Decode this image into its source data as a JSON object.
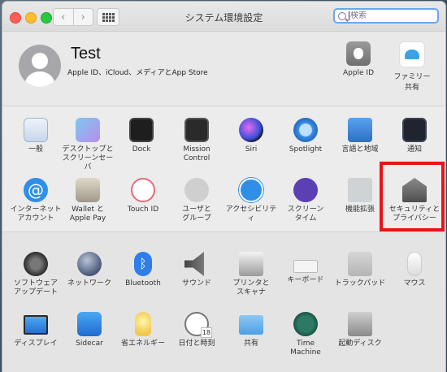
{
  "window": {
    "title": "システム環境設定"
  },
  "search": {
    "placeholder": "検索"
  },
  "account": {
    "name": "Test",
    "subtitle": "Apple ID、iCloud、メディアとApp Store",
    "apple_id_label": "Apple ID",
    "family_label_1": "ファミリー",
    "family_label_2": "共有"
  },
  "prefs": {
    "general": [
      "一般",
      ""
    ],
    "desktop": [
      "デスクトップと",
      "スクリーンセーバ"
    ],
    "dock": [
      "Dock",
      ""
    ],
    "mission": [
      "Mission",
      "Control"
    ],
    "siri": [
      "Siri",
      ""
    ],
    "spotlight": [
      "Spotlight",
      ""
    ],
    "language": [
      "言語と地域",
      ""
    ],
    "notifications": [
      "通知",
      ""
    ],
    "internet": [
      "インターネット",
      "アカウント"
    ],
    "wallet": [
      "Wallet と",
      "Apple Pay"
    ],
    "touchid": [
      "Touch ID",
      ""
    ],
    "users": [
      "ユーザと",
      "グループ"
    ],
    "accessibility": [
      "アクセシビリティ",
      ""
    ],
    "screentime": [
      "スクリーン",
      "タイム"
    ],
    "extensions": [
      "機能拡張",
      ""
    ],
    "security": [
      "セキュリティと",
      "プライバシー"
    ],
    "software": [
      "ソフトウェア",
      "アップデート"
    ],
    "network": [
      "ネットワーク",
      ""
    ],
    "bluetooth": [
      "Bluetooth",
      ""
    ],
    "sound": [
      "サウンド",
      ""
    ],
    "printers": [
      "プリンタと",
      "スキャナ"
    ],
    "keyboard": [
      "キーボード",
      ""
    ],
    "trackpad": [
      "トラックパッド",
      ""
    ],
    "mouse": [
      "マウス",
      ""
    ],
    "displays": [
      "ディスプレイ",
      ""
    ],
    "sidecar": [
      "Sidecar",
      ""
    ],
    "energy": [
      "省エネルギー",
      ""
    ],
    "datetime": [
      "日付と時刻",
      ""
    ],
    "sharing": [
      "共有",
      ""
    ],
    "timemachine": [
      "Time",
      "Machine"
    ],
    "startup": [
      "起動ディスク",
      ""
    ]
  },
  "datetime_icon": {
    "month": "JUL",
    "day": "18"
  },
  "colors": {
    "highlight": "#e8141a",
    "search_focus": "#6aa8ec"
  }
}
